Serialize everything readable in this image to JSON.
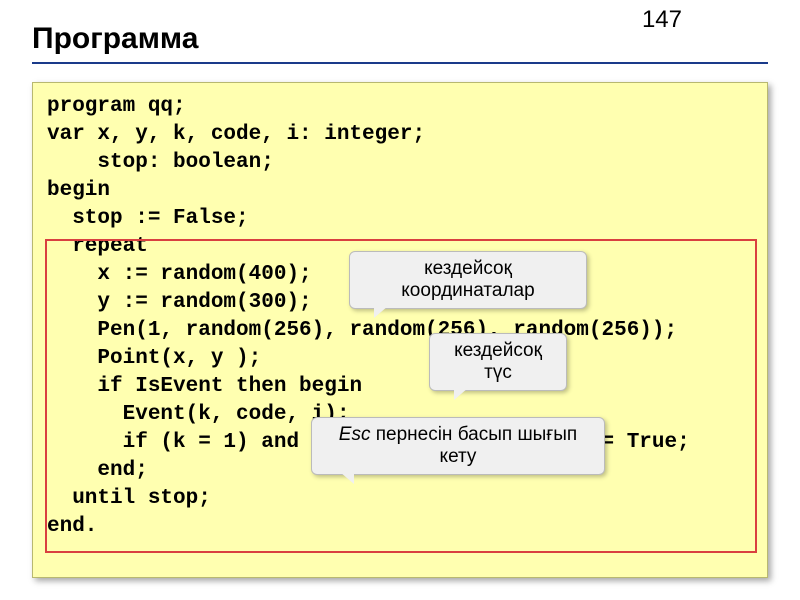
{
  "page_number": "147",
  "title": "Программа",
  "code_lines": [
    "program qq;",
    "var x, y, k, code, i: integer;",
    "    stop: boolean;",
    "begin",
    "  stop := False;",
    "  repeat",
    "    x := random(400);",
    "    y := random(300);",
    "    Pen(1, random(256), random(256), random(256));",
    "    Point(x, y );",
    "    if IsEvent then begin",
    "      Event(k, code, i);",
    "      if (k = 1) and (code = 27) then stop := True;",
    "    end;",
    "  until stop;",
    "end."
  ],
  "callouts": {
    "c1": "кездейсоқ координаталар",
    "c2": "кездейсоқ түс",
    "c3_prefix": "Esc",
    "c3_rest": " пернесін басып шығып кету"
  }
}
